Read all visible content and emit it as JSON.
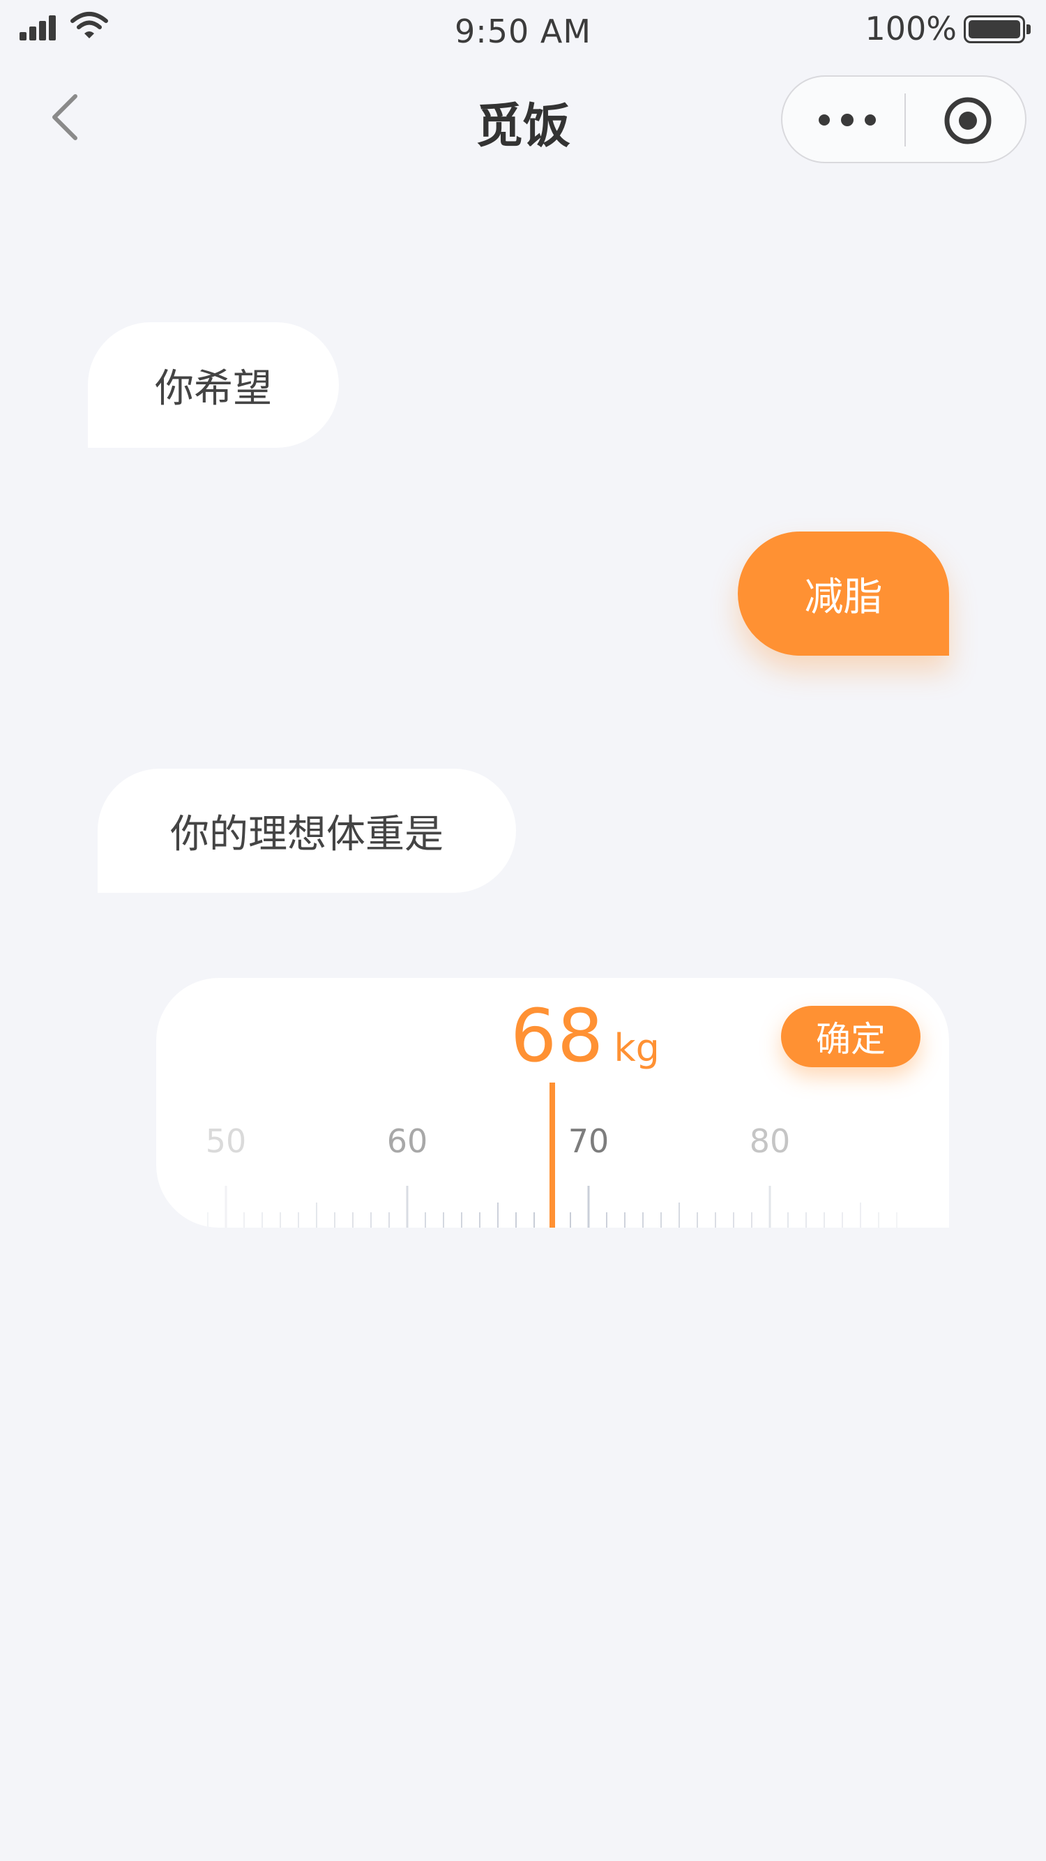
{
  "status_bar": {
    "time": "9:50 AM",
    "battery_percent": "100%",
    "battery_level": 1.0,
    "signal_icon": "cellular-signal-icon",
    "wifi_icon": "wifi-icon"
  },
  "nav": {
    "title": "觅饭",
    "back_icon": "chevron-left-icon",
    "more_icon": "more-dots-icon",
    "close_icon": "target-circle-icon"
  },
  "chat": {
    "question_1": "你希望",
    "answer_1": "减脂",
    "question_2": "你的理想体重是"
  },
  "weight_picker": {
    "value": "68",
    "unit": "kg",
    "confirm_label": "确定",
    "selected_value": 68,
    "range_min": 49,
    "range_max": 87,
    "major_labels": [
      "50",
      "60",
      "70",
      "80"
    ]
  },
  "colors": {
    "accent": "#ff9133",
    "background": "#f4f5f9",
    "bubble_bot": "#ffffff",
    "text_dark": "#444444",
    "tick": "#c6cbd6"
  }
}
